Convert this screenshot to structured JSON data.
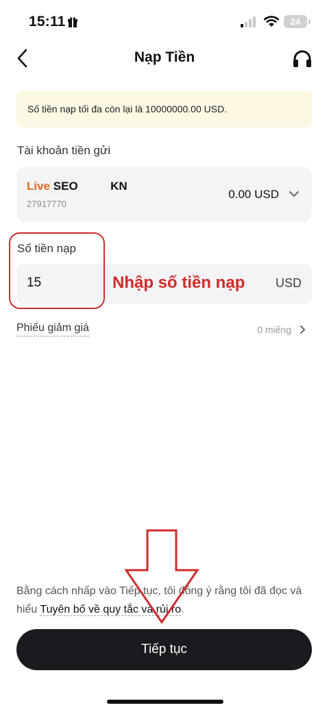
{
  "status_bar": {
    "time": "15:11",
    "battery": "24"
  },
  "header": {
    "title": "Nạp Tiền"
  },
  "notice": {
    "text": "Số tiền nạp tối đa còn lại là 10000000.00 USD."
  },
  "account": {
    "label": "Tài khoản tiền gửi",
    "type": "Live",
    "name_prefix": "SEO",
    "name_suffix": "KN",
    "number": "27917770",
    "balance": "0.00 USD"
  },
  "amount": {
    "label": "Số tiền nạp",
    "value": "15",
    "currency": "USD",
    "hint": "Nhập số tiền nạp"
  },
  "coupon": {
    "label": "Phiếu giảm giá",
    "count": "0 miếng"
  },
  "terms": {
    "text": "Bằng cách nhấp vào Tiếp tục, tôi đồng ý rằng tôi đã đọc và hiểu",
    "link": "Tuyên bố về quy tắc và rủi ro",
    "end": "."
  },
  "continue_button": {
    "label": "Tiếp tục"
  },
  "colors": {
    "accent_orange": "#e06a1c",
    "annotation_red": "#cf2b2b",
    "button_dark": "#1a1b1f",
    "notice_bg": "#fdf8e3"
  },
  "icons": [
    "gift-icon",
    "signal-icon",
    "wifi-icon",
    "battery-icon",
    "back-arrow-icon",
    "headset-icon",
    "chevron-down-icon",
    "chevron-right-icon",
    "down-arrow-annotation"
  ]
}
